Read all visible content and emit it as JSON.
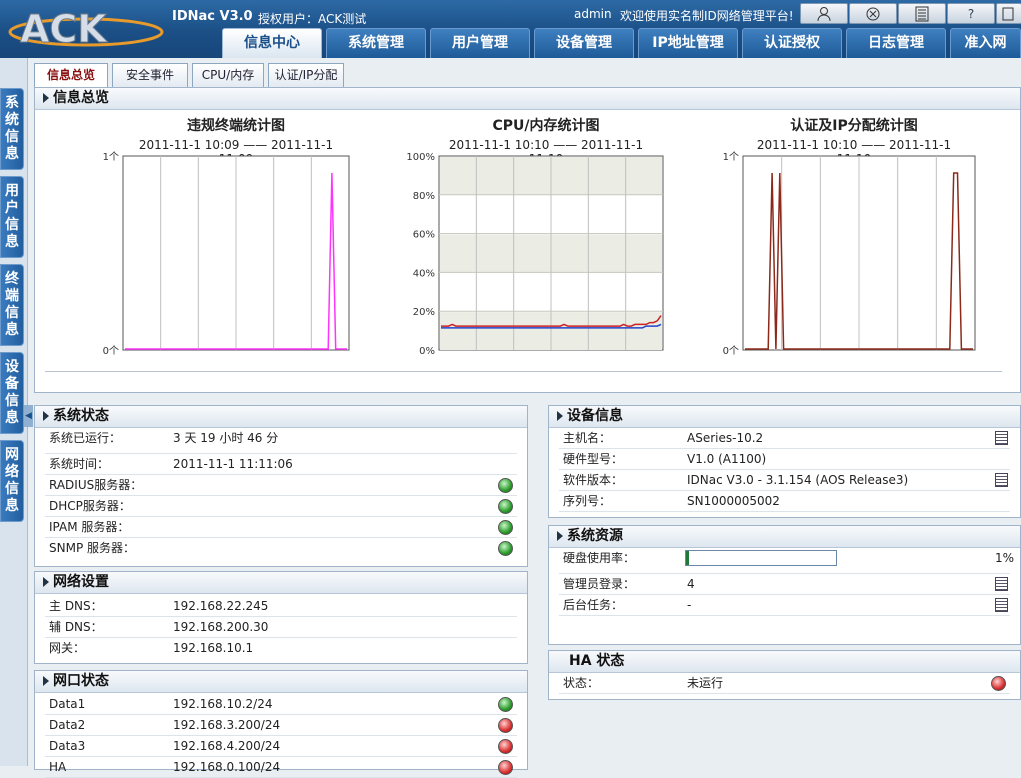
{
  "header": {
    "product": "IDNac V3.0",
    "license": "授权用户：ACK测试",
    "user": "admin",
    "welcome": "欢迎使用实名制ID网络管理平台!",
    "tool_icons": [
      "user-icon",
      "network-icon",
      "calculator-icon",
      "help-icon",
      "exit-icon"
    ],
    "tool_labels": [
      "",
      "",
      "",
      "?",
      ""
    ]
  },
  "logo_text": "ACK",
  "main_tabs": [
    {
      "label": "信息中心"
    },
    {
      "label": "系统管理"
    },
    {
      "label": "用户管理"
    },
    {
      "label": "设备管理"
    },
    {
      "label": "IP地址管理"
    },
    {
      "label": "认证授权"
    },
    {
      "label": "日志管理"
    },
    {
      "label": "准入网"
    }
  ],
  "side_tabs": [
    "系统信息",
    "用户信息",
    "终端信息",
    "设备信息",
    "网络信息"
  ],
  "sub_tabs": [
    "信息总览",
    "安全事件",
    "CPU/内存",
    "认证/IP分配"
  ],
  "overview": {
    "title": "信息总览"
  },
  "chart_data": [
    {
      "type": "line",
      "title": "违规终端统计图",
      "range": "2011-11-1 10:09 —— 2011-11-1 11:09",
      "yticks": [
        "1个",
        "0个"
      ],
      "ylim": [
        0,
        1
      ],
      "series": [
        {
          "color": "#ff33ff",
          "values": [
            0,
            0,
            0,
            0,
            0,
            0,
            0,
            0,
            0,
            0,
            0,
            0,
            0,
            0,
            0,
            0,
            0,
            0,
            0,
            0,
            0,
            0,
            0,
            0,
            0,
            0,
            0,
            0,
            0,
            0,
            0,
            0,
            0,
            0,
            0,
            0,
            0,
            0,
            0,
            0,
            0,
            0,
            0,
            0,
            0,
            0,
            0,
            0,
            0,
            0,
            0,
            0,
            0,
            0,
            0,
            1,
            0,
            0,
            0,
            0
          ]
        }
      ],
      "grid": true
    },
    {
      "type": "line",
      "title": "CPU/内存统计图",
      "range": "2011-11-1 10:10 —— 2011-11-1 11:10",
      "yticks": [
        "100%",
        "80%",
        "60%",
        "40%",
        "20%",
        "0%"
      ],
      "ylim": [
        0,
        100
      ],
      "series": [
        {
          "color": "#cc2222",
          "values": [
            13,
            13,
            13,
            14,
            13,
            13,
            13,
            13,
            13,
            13,
            13,
            13,
            13,
            13,
            13,
            13,
            13,
            13,
            13,
            13,
            13,
            13,
            13,
            13,
            13,
            13,
            13,
            13,
            13,
            13,
            13,
            13,
            13,
            14,
            13,
            13,
            13,
            13,
            13,
            13,
            13,
            13,
            13,
            13,
            13,
            13,
            13,
            13,
            13,
            14,
            13,
            13,
            14,
            14,
            14,
            14,
            15,
            15,
            16,
            19
          ]
        },
        {
          "color": "#2244cc",
          "values": [
            12,
            12,
            12,
            12,
            12,
            12,
            12,
            12,
            12,
            12,
            12,
            12,
            12,
            12,
            12,
            12,
            12,
            12,
            12,
            12,
            12,
            12,
            12,
            12,
            12,
            12,
            12,
            12,
            12,
            12,
            12,
            12,
            12,
            12,
            12,
            12,
            12,
            12,
            12,
            12,
            12,
            12,
            12,
            12,
            12,
            12,
            12,
            12,
            12,
            12,
            12,
            12,
            12,
            12,
            12,
            13,
            13,
            13,
            13,
            14
          ]
        }
      ],
      "grid": true,
      "bands": true
    },
    {
      "type": "line",
      "title": "认证及IP分配统计图",
      "range": "2011-11-1 10:10 —— 2011-11-1 11:10",
      "yticks": [
        "1个",
        "0个"
      ],
      "ylim": [
        0,
        1
      ],
      "series": [
        {
          "color": "#8b2a1a",
          "values": [
            0,
            0,
            0,
            0,
            0,
            0,
            0,
            1,
            0,
            1,
            0,
            0,
            0,
            0,
            0,
            0,
            0,
            0,
            0,
            0,
            0,
            0,
            0,
            0,
            0,
            0,
            0,
            0,
            0,
            0,
            0,
            0,
            0,
            0,
            0,
            0,
            0,
            0,
            0,
            0,
            0,
            0,
            0,
            0,
            0,
            0,
            0,
            0,
            0,
            0,
            0,
            0,
            0,
            0,
            1,
            1,
            0,
            0,
            0,
            0
          ]
        }
      ],
      "grid": true
    }
  ],
  "system_status": {
    "title": "系统状态",
    "uptime_label": "系统已运行：",
    "uptime": "3 天  19 小时  46 分",
    "time_label": "系统时间：",
    "time": "2011-11-1 11:11:06",
    "servers": [
      {
        "label": "RADIUS服务器：",
        "status": "ok"
      },
      {
        "label": "DHCP服务器：",
        "status": "ok"
      },
      {
        "label": "IPAM 服务器：",
        "status": "ok"
      },
      {
        "label": "SNMP 服务器：",
        "status": "ok"
      }
    ]
  },
  "network": {
    "title": "网络设置",
    "rows": [
      {
        "label": "主 DNS：",
        "value": "192.168.22.245"
      },
      {
        "label": "辅 DNS：",
        "value": "192.168.200.30"
      },
      {
        "label": "网关：",
        "value": "192.168.10.1"
      }
    ]
  },
  "ports": {
    "title": "网口状态",
    "rows": [
      {
        "label": "Data1",
        "value": "192.168.10.2/24",
        "status": "ok"
      },
      {
        "label": "Data2",
        "value": "192.168.3.200/24",
        "status": "bad"
      },
      {
        "label": "Data3",
        "value": "192.168.4.200/24",
        "status": "bad"
      },
      {
        "label": "HA",
        "value": "192.168.0.100/24",
        "status": "bad"
      }
    ]
  },
  "device": {
    "title": "设备信息",
    "rows": [
      {
        "label": "主机名：",
        "value": "ASeries-10.2",
        "icon": "edit-icon"
      },
      {
        "label": "硬件型号：",
        "value": "V1.0 (A1100)"
      },
      {
        "label": "软件版本：",
        "value": "IDNac V3.0 - 3.1.154 (AOS Release3)",
        "icon": "document-icon"
      },
      {
        "label": "序列号：",
        "value": "SN1000005002"
      }
    ]
  },
  "resources": {
    "title": "系统资源",
    "disk_label": "硬盘使用率：",
    "disk_percent": 1,
    "disk_text": "1%",
    "admin_label": "管理员登录：",
    "admin_value": "4",
    "task_label": "后台任务：",
    "task_value": "-"
  },
  "ha": {
    "title": "HA 状态",
    "status_label": "状态：",
    "status_value": "未运行",
    "status": "bad"
  }
}
